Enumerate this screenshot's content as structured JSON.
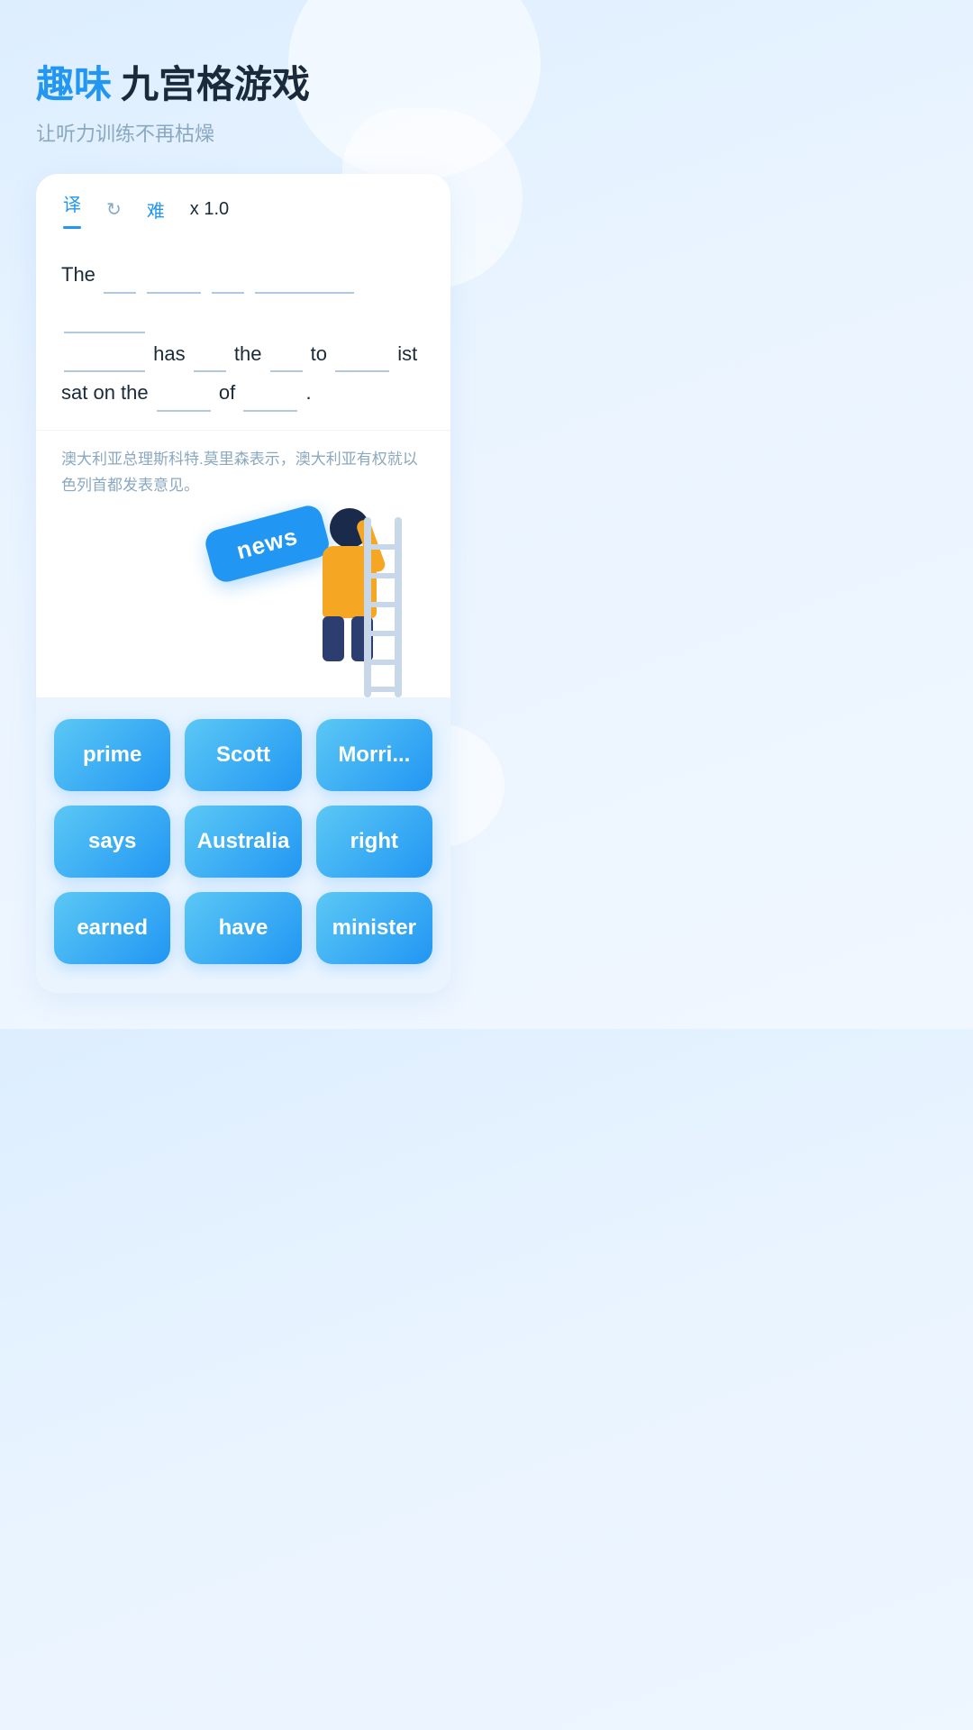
{
  "header": {
    "title_blue": "趣味",
    "title_dark": "九宫格游戏",
    "subtitle": "让听力训练不再枯燥"
  },
  "tabs": {
    "translate_label": "译",
    "refresh_label": "↻",
    "difficulty_label": "难",
    "speed_label": "x 1.0"
  },
  "sentence": {
    "text": "The ___ ______ ___ _________ _____ ________has ___ the ___ to _____ist sat on the ____ of ____.",
    "translation": "澳大利亚总理斯科特.莫里森表示，澳大利亚有权就以色列首都发表意见。"
  },
  "news_badge": {
    "label": "news"
  },
  "word_buttons": [
    {
      "id": "btn-prime",
      "label": "prime"
    },
    {
      "id": "btn-scott",
      "label": "Scott"
    },
    {
      "id": "btn-morrison",
      "label": "Morri..."
    },
    {
      "id": "btn-says",
      "label": "says"
    },
    {
      "id": "btn-australia",
      "label": "Australia"
    },
    {
      "id": "btn-right",
      "label": "right"
    },
    {
      "id": "btn-earned",
      "label": "earned"
    },
    {
      "id": "btn-have",
      "label": "have"
    },
    {
      "id": "btn-minister",
      "label": "minister"
    }
  ]
}
